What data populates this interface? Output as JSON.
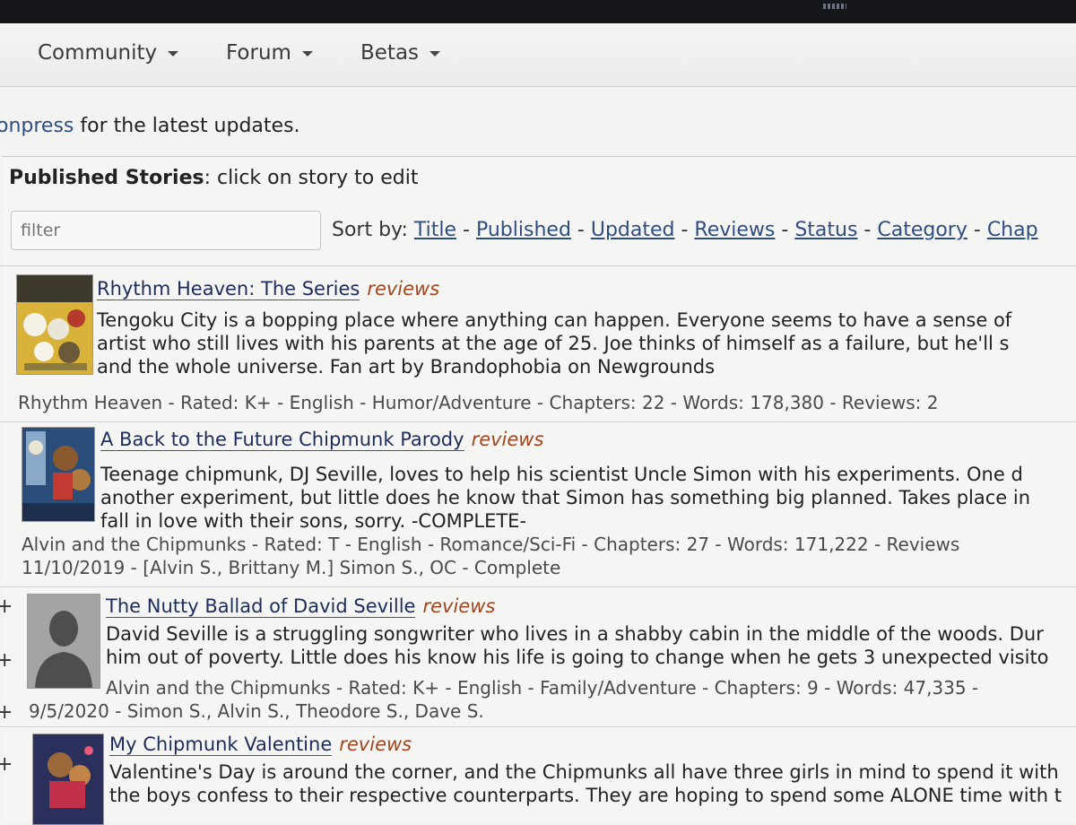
{
  "nav": {
    "items": [
      "Community",
      "Forum",
      "Betas"
    ]
  },
  "notice": {
    "link_fragment": "onpress",
    "text": " for the latest updates."
  },
  "list_header": {
    "label": "Published Stories",
    "hint": ": click on story to edit"
  },
  "filter": {
    "placeholder": "filter"
  },
  "sort": {
    "label": "Sort by: ",
    "options": [
      "Title",
      "Published",
      "Updated",
      "Reviews",
      "Status",
      "Category",
      "Chap"
    ]
  },
  "stories": [
    {
      "title": "Rhythm Heaven: The Series",
      "reviews_link": "reviews",
      "summary": [
        "Tengoku City is a bopping place where anything can happen. Everyone seems to have a sense of",
        "artist who still lives with his parents at the age of 25. Joe thinks of himself as a failure, but he'll s",
        "and the whole universe. Fan art by Brandophobia on Newgrounds"
      ],
      "meta": [
        "Rhythm Heaven - Rated: K+ - English - Humor/Adventure - Chapters: 22 - Words: 178,380 - Reviews: 2"
      ]
    },
    {
      "title": "A Back to the Future Chipmunk Parody",
      "reviews_link": "reviews",
      "summary": [
        "Teenage chipmunk, DJ Seville, loves to help his scientist Uncle Simon with his experiments. One d",
        "another experiment, but little does he know that Simon has something big planned. Takes place in",
        "fall in love with their sons, sorry. -COMPLETE-"
      ],
      "meta": [
        "Alvin and the Chipmunks - Rated: T - English - Romance/Sci-Fi - Chapters: 27 - Words: 171,222 - Reviews",
        "11/10/2019 - [Alvin S., Brittany M.] Simon S., OC - Complete"
      ]
    },
    {
      "title": "The Nutty Ballad of David Seville",
      "reviews_link": "reviews",
      "summary": [
        "David Seville is a struggling songwriter who lives in a shabby cabin in the middle of the woods. Dur",
        "him out of poverty. Little does his know his life is going to change when he gets 3 unexpected visito"
      ],
      "meta": [
        "Alvin and the Chipmunks - Rated: K+ - English - Family/Adventure - Chapters: 9 - Words: 47,335 -",
        "9/5/2020 - Simon S., Alvin S., Theodore S., Dave S."
      ]
    },
    {
      "title": "My Chipmunk Valentine",
      "reviews_link": "reviews",
      "summary": [
        "Valentine's Day is around the corner, and the Chipmunks all have three girls in mind to spend it with",
        "the boys confess to their respective counterparts. They are hoping to spend some ALONE time with t"
      ],
      "meta": []
    }
  ],
  "expand_glyph": "+",
  "colors": {
    "link": "#2f4d80",
    "title": "#1e2c5a",
    "reviews": "#a0461e",
    "background": "#f3f3f1"
  }
}
